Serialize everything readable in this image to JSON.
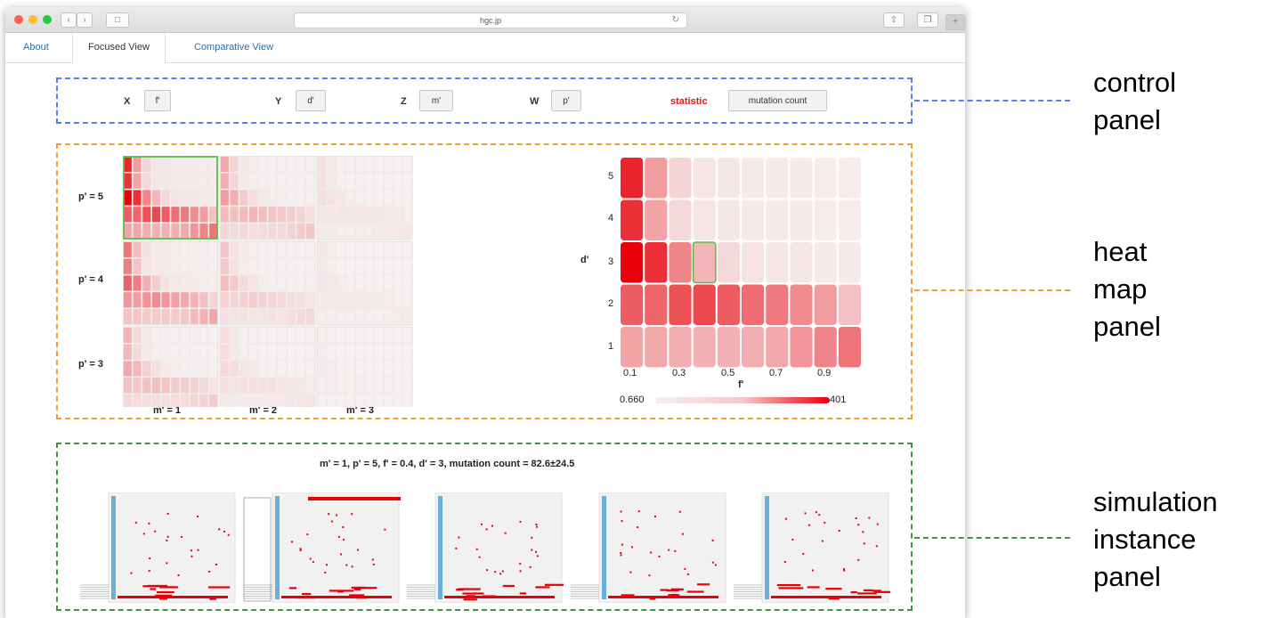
{
  "browser": {
    "url": "hgc.jp",
    "nav_back_icon": "chevron-left-icon",
    "nav_forward_icon": "chevron-right-icon",
    "sidebar_icon": "sidebar-icon",
    "reload_icon": "reload-icon",
    "share_icon": "share-icon",
    "tabs_icon": "tabs-icon",
    "new_tab_icon": "plus-icon",
    "traffic_lights": [
      "#ff5f57",
      "#febc2e",
      "#28c840"
    ]
  },
  "tabs": [
    {
      "label": "About"
    },
    {
      "label": "Focused View"
    },
    {
      "label": "Comparative View"
    }
  ],
  "controls": {
    "x_label": "X",
    "x_value": "f'",
    "y_label": "Y",
    "y_value": "d'",
    "z_label": "Z",
    "z_value": "m'",
    "w_label": "W",
    "w_value": "p'",
    "statistic_label": "statistic",
    "statistic_value": "mutation count"
  },
  "small_multiples": {
    "row_labels": [
      "p' = 5",
      "p' = 4",
      "p' = 3"
    ],
    "col_labels": [
      "m' = 1",
      "m' = 2",
      "m' = 3"
    ]
  },
  "heatmap": {
    "y_label": "d'",
    "x_label": "f'",
    "y_ticks": [
      "5",
      "4",
      "3",
      "2",
      "1"
    ],
    "x_ticks": [
      "0.1",
      "0.3",
      "0.5",
      "0.7",
      "0.9"
    ],
    "legend_min": "0.660",
    "legend_max": "401",
    "low_color": "#f3f0f0",
    "high_color": "#e8000a",
    "selection_color": "#5bbf4a"
  },
  "chart_data": {
    "type": "heatmap",
    "x": [
      0.1,
      0.2,
      0.3,
      0.4,
      0.5,
      0.6,
      0.7,
      0.8,
      0.9,
      1.0
    ],
    "y": [
      5,
      4,
      3,
      2,
      1
    ],
    "x_ticks": [
      "0.1",
      "0.3",
      "0.5",
      "0.7",
      "0.9"
    ],
    "y_ticks": [
      "5",
      "4",
      "3",
      "2",
      "1"
    ],
    "xlabel": "f'",
    "ylabel": "d'",
    "color_range": [
      0.66,
      401
    ],
    "intensity": [
      [
        0.85,
        0.35,
        0.12,
        0.05,
        0.04,
        0.03,
        0.03,
        0.03,
        0.02,
        0.02
      ],
      [
        0.8,
        0.32,
        0.1,
        0.05,
        0.04,
        0.03,
        0.03,
        0.03,
        0.02,
        0.02
      ],
      [
        1.0,
        0.8,
        0.45,
        0.25,
        0.1,
        0.06,
        0.05,
        0.04,
        0.03,
        0.03
      ],
      [
        0.62,
        0.58,
        0.66,
        0.7,
        0.62,
        0.55,
        0.5,
        0.42,
        0.35,
        0.2
      ],
      [
        0.32,
        0.3,
        0.28,
        0.26,
        0.26,
        0.28,
        0.3,
        0.38,
        0.45,
        0.52
      ]
    ],
    "selected_cell": {
      "f": 0.4,
      "d": 3
    }
  },
  "simulation": {
    "title": "m' = 1, p' = 5, f' = 0.4, d' = 3, mutation count = 82.6±24.5",
    "instances": [
      {
        "name": "simulation-instance-1"
      },
      {
        "name": "simulation-instance-2"
      },
      {
        "name": "simulation-instance-3"
      },
      {
        "name": "simulation-instance-4"
      },
      {
        "name": "simulation-instance-5"
      }
    ]
  },
  "annotations": {
    "control_line1": "control",
    "control_line2": "panel",
    "heat_line1": "heat",
    "heat_line2": "map",
    "heat_line3": "panel",
    "sim_line1": "simulation",
    "sim_line2": "instance",
    "sim_line3": "panel",
    "control_color": "#5a7cf0",
    "heat_color": "#f0a030",
    "sim_color": "#3a9a3a"
  }
}
